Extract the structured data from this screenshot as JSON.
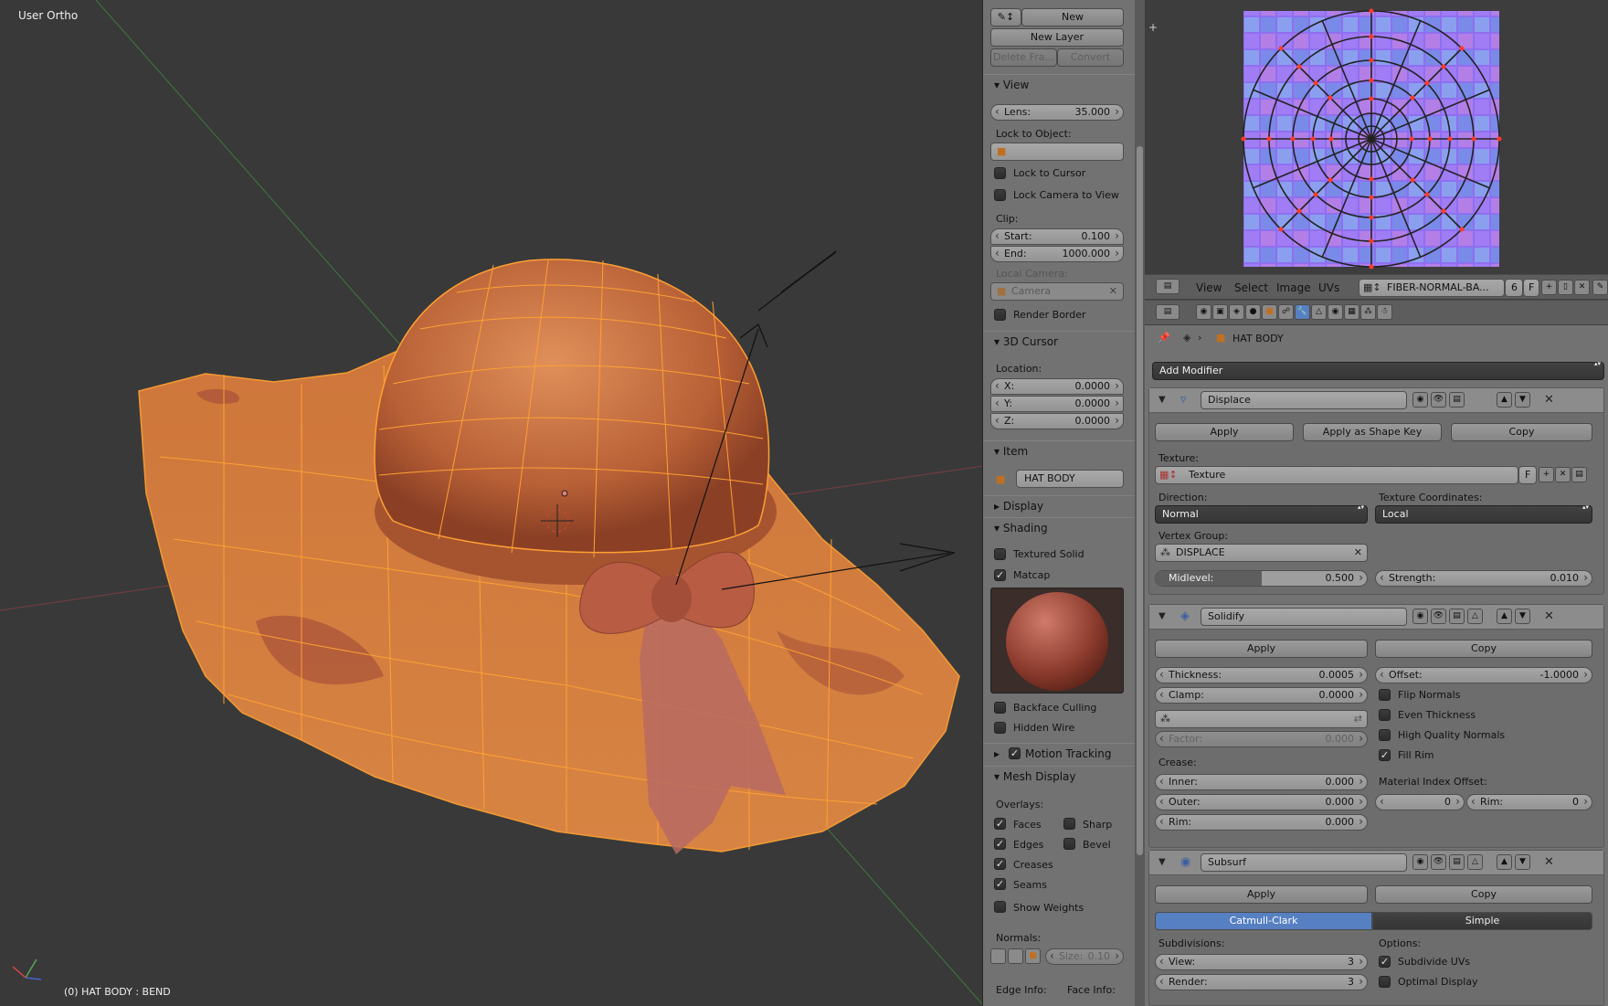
{
  "viewport": {
    "view_label": "User Ortho",
    "status": "(0) HAT BODY : BEND"
  },
  "npanel": {
    "grease": {
      "new": "New",
      "new_layer": "New Layer",
      "delete_frame": "Delete Fra...",
      "convert": "Convert"
    },
    "view": {
      "title": "View",
      "lens_label": "Lens:",
      "lens_value": "35.000",
      "lock_to_object": "Lock to Object:",
      "lock_to_cursor": "Lock to Cursor",
      "lock_camera": "Lock Camera to View",
      "clip": "Clip:",
      "start_label": "Start:",
      "start_value": "0.100",
      "end_label": "End:",
      "end_value": "1000.000",
      "local_camera": "Local Camera:",
      "camera": "Camera",
      "render_border": "Render Border"
    },
    "cursor": {
      "title": "3D Cursor",
      "location": "Location:",
      "x_label": "X:",
      "x_value": "0.0000",
      "y_label": "Y:",
      "y_value": "0.0000",
      "z_label": "Z:",
      "z_value": "0.0000"
    },
    "item": {
      "title": "Item",
      "name": "HAT BODY"
    },
    "display": {
      "title": "Display"
    },
    "shading": {
      "title": "Shading",
      "textured_solid": "Textured Solid",
      "matcap": "Matcap",
      "backface": "Backface Culling",
      "hidden_wire": "Hidden Wire"
    },
    "motion": {
      "title": "Motion Tracking"
    },
    "mesh": {
      "title": "Mesh Display",
      "overlays": "Overlays:",
      "faces": "Faces",
      "sharp": "Sharp",
      "edges": "Edges",
      "bevel": "Bevel",
      "creases": "Creases",
      "seams": "Seams",
      "weights": "Show Weights",
      "normals": "Normals:",
      "size_label": "Size:",
      "size_value": "0.10",
      "edge_info": "Edge Info:",
      "face_info": "Face Info:"
    }
  },
  "uv_header": {
    "view": "View",
    "select": "Select",
    "image": "Image",
    "uvs": "UVs",
    "image_name": "FIBER-NORMAL-BA...",
    "users": "6",
    "fake": "F"
  },
  "properties": {
    "object_name": "HAT BODY",
    "add_modifier": "Add Modifier",
    "displace": {
      "name": "Displace",
      "apply": "Apply",
      "apply_shape": "Apply as Shape Key",
      "copy": "Copy",
      "texture_label": "Texture:",
      "texture": "Texture",
      "tex_f": "F",
      "direction_label": "Direction:",
      "direction": "Normal",
      "coords_label": "Texture Coordinates:",
      "coords": "Local",
      "vgroup_label": "Vertex Group:",
      "vgroup": "DISPLACE",
      "midlevel_label": "Midlevel:",
      "midlevel_value": "0.500",
      "midlevel_fraction": 0.5,
      "strength_label": "Strength:",
      "strength_value": "0.010"
    },
    "solidify": {
      "name": "Solidify",
      "apply": "Apply",
      "copy": "Copy",
      "thickness_label": "Thickness:",
      "thickness_value": "0.0005",
      "offset_label": "Offset:",
      "offset_value": "-1.0000",
      "clamp_label": "Clamp:",
      "clamp_value": "0.0000",
      "flip": "Flip Normals",
      "even": "Even Thickness",
      "hq": "High Quality Normals",
      "fill": "Fill Rim",
      "factor_label": "Factor:",
      "factor_value": "0.000",
      "crease_label": "Crease:",
      "inner_label": "Inner:",
      "inner_value": "0.000",
      "outer_label": "Outer:",
      "outer_value": "0.000",
      "rim_label": "Rim:",
      "rim_value": "0.000",
      "mat_label": "Material Index Offset:",
      "mat_value": "0",
      "mat_rim_label": "Rim:",
      "mat_rim_value": "0"
    },
    "subsurf": {
      "name": "Subsurf",
      "apply": "Apply",
      "copy": "Copy",
      "catmull": "Catmull-Clark",
      "simple": "Simple",
      "subdiv_label": "Subdivisions:",
      "options_label": "Options:",
      "view_label": "View:",
      "view_value": "3",
      "render_label": "Render:",
      "render_value": "3",
      "subdivide_uvs": "Subdivide UVs",
      "optimal": "Optimal Display"
    }
  },
  "colors": {
    "accent": "#5680c2",
    "orange": "#ffa033",
    "hat": "#c8683a"
  }
}
